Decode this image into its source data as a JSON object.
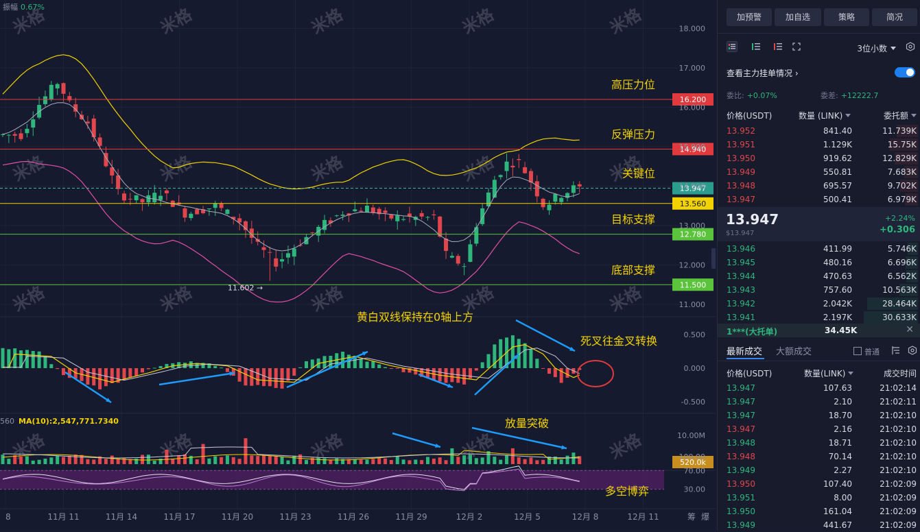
{
  "top_info": {
    "label": "振幅",
    "value": "0.67%"
  },
  "watermark": "米格",
  "price_axis": [
    "18.000",
    "17.000",
    "16.000",
    "15.000",
    "14.000",
    "13.000",
    "12.000",
    "11.000"
  ],
  "macd_axis": [
    "0.500",
    "0.000",
    "-0.500"
  ],
  "vol_axis": [
    "10.00M"
  ],
  "rsi_axis": [
    "100.00",
    "70.00",
    "30.00"
  ],
  "x_axis": [
    "8",
    "11月 11",
    "11月 14",
    "11月 17",
    "11月 20",
    "11月 23",
    "11月 26",
    "11月 29",
    "12月 2",
    "12月 5",
    "12月 8",
    "12月 11"
  ],
  "x_axis_tail": [
    "筹",
    "爆"
  ],
  "levels": [
    {
      "label": "高压力位",
      "price": "16.200",
      "color": "#e03a3e"
    },
    {
      "label": "反弹压力",
      "price": "14.940",
      "color": "#e03a3e"
    },
    {
      "label": "关键位",
      "price": "13.947",
      "color": "#2a9d8f"
    },
    {
      "label": "",
      "price": "13.560",
      "color": "#f2d300"
    },
    {
      "label": "目标支撑",
      "price": "12.780",
      "color": "#5cc33c"
    },
    {
      "label": "底部支撑",
      "price": "11.500",
      "color": "#5cc33c"
    }
  ],
  "low_marker": "11.602 →",
  "macd_annotations": [
    "黄白双线保持在0轴上方",
    "死叉往金叉转换"
  ],
  "vol_annotation": "放量突破",
  "rsi_annotation": "多空博弈",
  "vol_legend": {
    "prefix": "560",
    "label": "MA(10):2,547,771.7340"
  },
  "vol_tag": "520.0k",
  "buttons": [
    "加预警",
    "加自选",
    "策略",
    "简况"
  ],
  "decimals": "3位小数",
  "main_order_label": "查看主力挂单情况",
  "commission_ratio": {
    "label": "委比:",
    "value": "+0.07%"
  },
  "commission_diff": {
    "label": "委差:",
    "value": "+12222.7"
  },
  "orderbook_headers": [
    "价格(USDT)",
    "数量 (LINK)",
    "委托额"
  ],
  "asks": [
    {
      "price": "13.952",
      "qty": "841.40",
      "total": "11.739K",
      "depth": 0.42
    },
    {
      "price": "13.951",
      "qty": "1.129K",
      "total": "15.75K",
      "depth": 0.56
    },
    {
      "price": "13.950",
      "qty": "919.62",
      "total": "12.829K",
      "depth": 0.46
    },
    {
      "price": "13.949",
      "qty": "550.81",
      "total": "7.683K",
      "depth": 0.27
    },
    {
      "price": "13.948",
      "qty": "695.57",
      "total": "9.702K",
      "depth": 0.35
    },
    {
      "price": "13.947",
      "qty": "500.41",
      "total": "6.979K",
      "depth": 0.25
    }
  ],
  "last_price": {
    "price": "13.947",
    "usd": "$13.947",
    "change_pct": "+2.24%",
    "change": "+0.306"
  },
  "bids": [
    {
      "price": "13.946",
      "qty": "411.99",
      "total": "5.746K",
      "depth": 0.2
    },
    {
      "price": "13.945",
      "qty": "480.16",
      "total": "6.696K",
      "depth": 0.24
    },
    {
      "price": "13.944",
      "qty": "470.63",
      "total": "6.562K",
      "depth": 0.23
    },
    {
      "price": "13.943",
      "qty": "757.60",
      "total": "10.563K",
      "depth": 0.37
    },
    {
      "price": "13.942",
      "qty": "2.042K",
      "total": "28.464K",
      "depth": 1.0
    },
    {
      "price": "13.941",
      "qty": "2.197K",
      "total": "30.633K",
      "depth": 1.07
    }
  ],
  "big_order": {
    "label": "1***(大托单)",
    "value": "34.45K",
    "close": "✕"
  },
  "trade_tabs": [
    "最新成交",
    "大额成交"
  ],
  "normal_label": "普通",
  "trade_headers": [
    "价格(USDT)",
    "数量(LINK)",
    "成交时间"
  ],
  "trades": [
    {
      "price": "13.947",
      "qty": "107.63",
      "time": "21:02:14",
      "side": "buy"
    },
    {
      "price": "13.947",
      "qty": "2.10",
      "time": "21:02:11",
      "side": "buy"
    },
    {
      "price": "13.947",
      "qty": "18.70",
      "time": "21:02:10",
      "side": "buy"
    },
    {
      "price": "13.947",
      "qty": "2.16",
      "time": "21:02:10",
      "side": "sell"
    },
    {
      "price": "13.948",
      "qty": "18.71",
      "time": "21:02:10",
      "side": "buy"
    },
    {
      "price": "13.948",
      "qty": "70.14",
      "time": "21:02:10",
      "side": "sell"
    },
    {
      "price": "13.949",
      "qty": "2.27",
      "time": "21:02:10",
      "side": "buy"
    },
    {
      "price": "13.950",
      "qty": "107.40",
      "time": "21:02:09",
      "side": "sell"
    },
    {
      "price": "13.951",
      "qty": "8.00",
      "time": "21:02:09",
      "side": "buy"
    },
    {
      "price": "13.950",
      "qty": "161.04",
      "time": "21:02:09",
      "side": "buy"
    },
    {
      "price": "13.949",
      "qty": "441.67",
      "time": "21:02:09",
      "side": "buy"
    }
  ],
  "colors": {
    "up": "#2fb67c",
    "down": "#e0464b",
    "accent": "#1d7ff0",
    "annotation": "#f2d300"
  }
}
